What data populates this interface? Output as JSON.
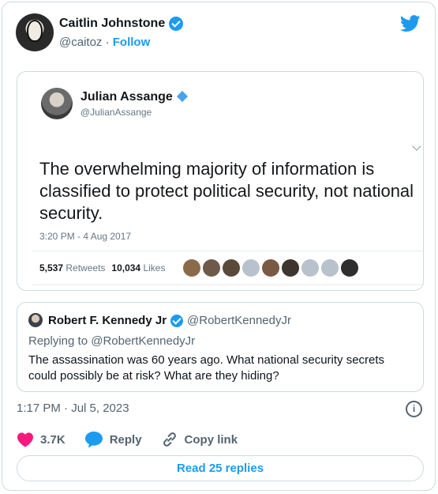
{
  "header": {
    "name": "Caitlin Johnstone",
    "handle": "@caitoz",
    "separator": "·",
    "follow_label": "Follow",
    "icon": "twitter-bird-icon"
  },
  "embedded": {
    "name": "Julian Assange",
    "handle": "@JulianAssange",
    "text": "The overwhelming majority of information is classified to protect political security, not national security.",
    "timestamp": "3:20 PM - 4 Aug 2017",
    "retweets_count": "5,537",
    "retweets_label": "Retweets",
    "likes_count": "10,034",
    "likes_label": "Likes",
    "liker_colors": [
      "#8b6a4a",
      "#6e5a4a",
      "#5a4a3a",
      "#b8c2cc",
      "#7a5a45",
      "#3e352e",
      "#b8c2cc",
      "#b8c2cc",
      "#2e2e2e"
    ]
  },
  "quote": {
    "name": "Robert F. Kennedy Jr",
    "handle": "@RobertKennedyJr",
    "replying": "Replying to @RobertKennedyJr",
    "text": "The assassination was 60 years ago. What national security secrets could possibly be at risk? What are they hiding?"
  },
  "footer": {
    "time": "1:17 PM · Jul 5, 2023",
    "likes": "3.7K",
    "reply_label": "Reply",
    "copy_label": "Copy link",
    "read_label": "Read 25 replies"
  },
  "colors": {
    "accent": "#1d9bf0",
    "heart": "#f91880",
    "muted": "#536471"
  }
}
